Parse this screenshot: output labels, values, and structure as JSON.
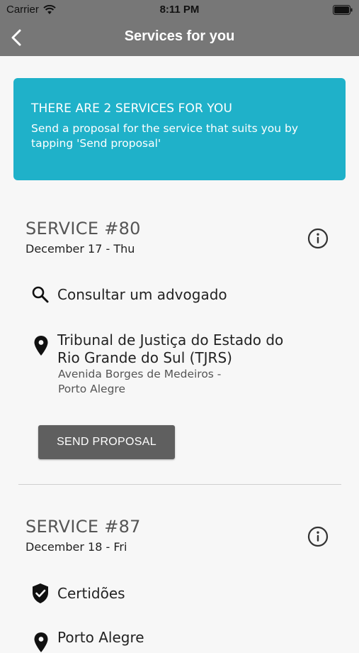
{
  "status_bar": {
    "carrier": "Carrier",
    "time": "8:11 PM"
  },
  "nav": {
    "title": "Services for you"
  },
  "banner": {
    "heading": "THERE ARE 2 SERVICES FOR YOU",
    "description": "Send a proposal for the service that suits you by tapping 'Send proposal'"
  },
  "services": [
    {
      "title": "SERVICE #80",
      "date": "December 17 - Thu",
      "category": "Consultar um advogado",
      "category_icon": "search-icon",
      "location_name_line1": "Tribunal de Justiça do Estado do",
      "location_name_line2": "Rio Grande do Sul (TJRS)",
      "address_line1": "Avenida Borges de Medeiros -",
      "address_line2": "Porto Alegre",
      "button_label": "SEND PROPOSAL"
    },
    {
      "title": "SERVICE #87",
      "date": "December 18 - Fri",
      "category": "Certidões",
      "category_icon": "shield-check-icon",
      "location_name_line1": "Porto Alegre"
    }
  ]
}
